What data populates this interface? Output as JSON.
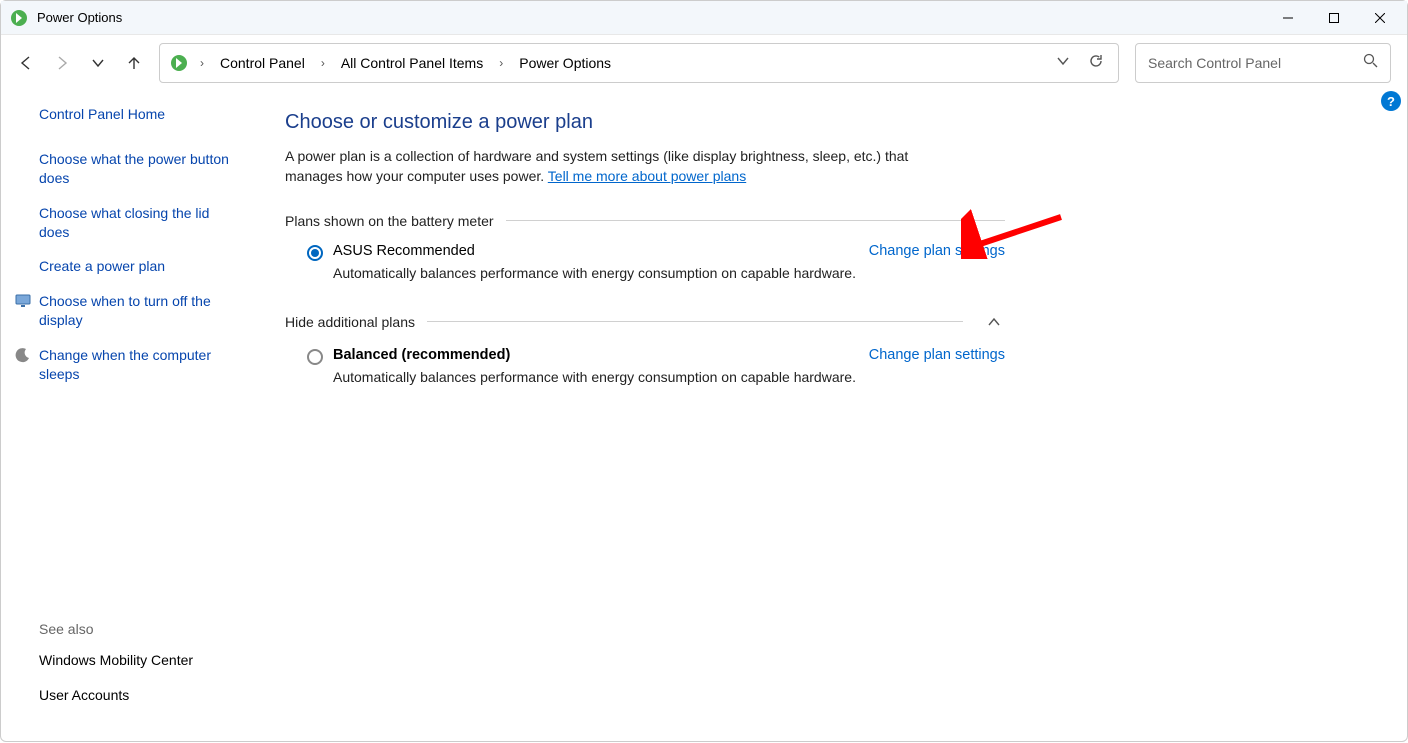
{
  "window": {
    "title": "Power Options"
  },
  "breadcrumb": {
    "items": [
      "Control Panel",
      "All Control Panel Items",
      "Power Options"
    ]
  },
  "search": {
    "placeholder": "Search Control Panel"
  },
  "sidebar": {
    "home": "Control Panel Home",
    "links": [
      "Choose what the power button does",
      "Choose what closing the lid does",
      "Create a power plan",
      "Choose when to turn off the display",
      "Change when the computer sleeps"
    ],
    "see_also_heading": "See also",
    "see_also": [
      "Windows Mobility Center",
      "User Accounts"
    ]
  },
  "main": {
    "heading": "Choose or customize a power plan",
    "intro_pre": "A power plan is a collection of hardware and system settings (like display brightness, sleep, etc.) that manages how your computer uses power. ",
    "intro_link": "Tell me more about power plans",
    "group1_label": "Plans shown on the battery meter",
    "plan1": {
      "name": "ASUS Recommended",
      "desc": "Automatically balances performance with energy consumption on capable hardware.",
      "link": "Change plan settings"
    },
    "group2_label": "Hide additional plans",
    "plan2": {
      "name": "Balanced (recommended)",
      "desc": "Automatically balances performance with energy consumption on capable hardware.",
      "link": "Change plan settings"
    }
  },
  "help_badge": "?"
}
